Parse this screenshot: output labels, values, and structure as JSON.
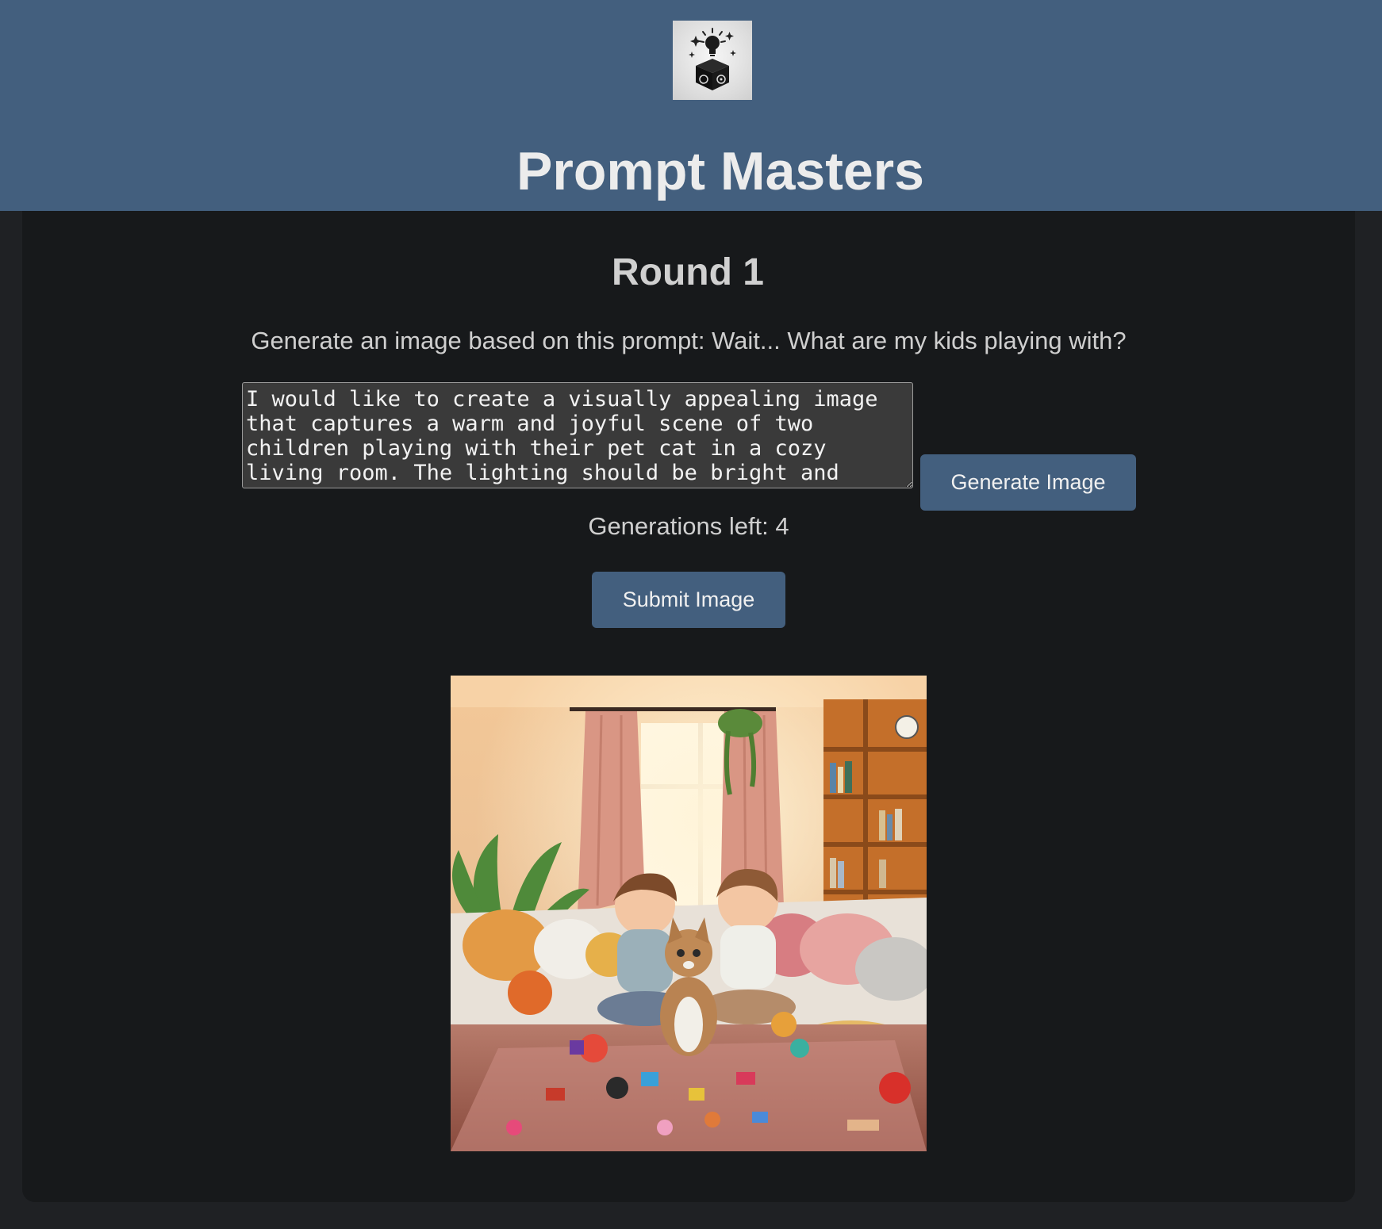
{
  "header": {
    "title": "Prompt Masters",
    "logo_icon": "lightbulb-dice-icon"
  },
  "round": {
    "title": "Round 1",
    "prompt_text": "Generate an image based on this prompt: Wait... What are my kids playing with?"
  },
  "input": {
    "value": "I would like to create a visually appealing image that captures a warm and joyful scene of two children playing with their pet cat in a cozy living room. The lighting should be bright and inviting,"
  },
  "buttons": {
    "generate_label": "Generate Image",
    "submit_label": "Submit Image"
  },
  "status": {
    "generations_left": "Generations left: 4"
  },
  "colors": {
    "header_bg": "#435f7e",
    "page_bg": "#1f2124",
    "panel_bg": "#17191b",
    "button_bg": "#435f7e"
  }
}
